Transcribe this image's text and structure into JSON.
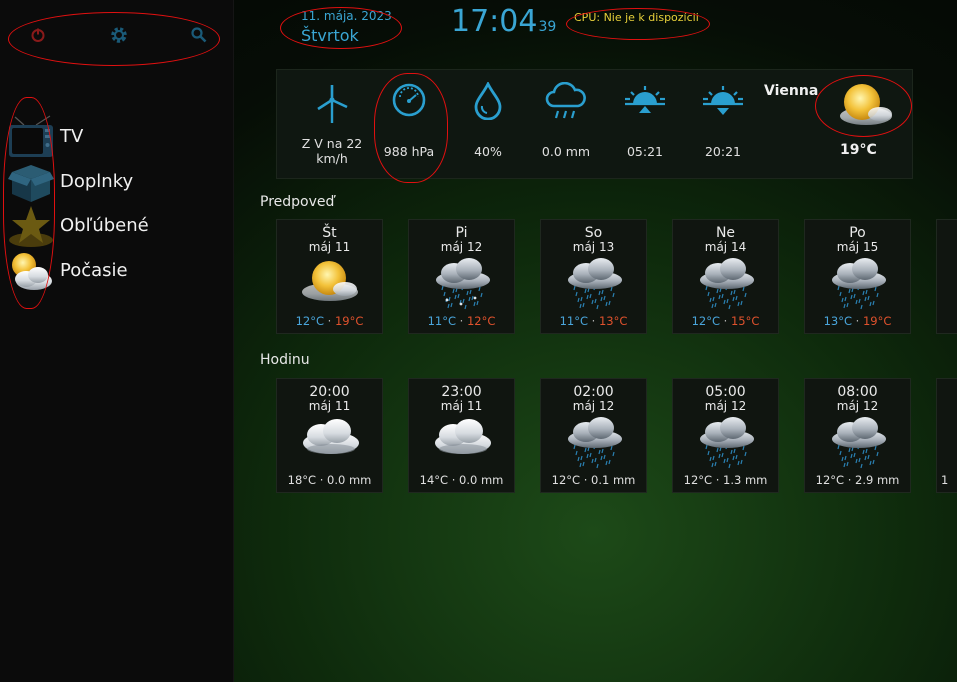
{
  "header": {
    "date": "11. mája. 2023",
    "weekday": "Štvrtok",
    "time": "17:04",
    "seconds": "39",
    "cpu": "CPU: Nie je k dispozícii"
  },
  "sidebar": {
    "top_icons": [
      "power-icon",
      "gear-icon",
      "search-icon"
    ],
    "items": [
      {
        "label": "TV",
        "icon": "tv-icon"
      },
      {
        "label": "Doplnky",
        "icon": "box-icon"
      },
      {
        "label": "Obľúbené",
        "icon": "star-icon"
      },
      {
        "label": "Počasie",
        "icon": "weather-icon"
      }
    ]
  },
  "current": {
    "wind": "Z V na 22 km/h",
    "wind_line1": "Z V na 22",
    "wind_line2": "km/h",
    "pressure": "988 hPa",
    "humidity": "40%",
    "precipitation": "0.0 mm",
    "sunrise": "05:21",
    "sunset": "20:21",
    "city": "Vienna",
    "temperature": "19°C"
  },
  "forecast": {
    "title": "Predpoveď",
    "days": [
      {
        "day": "Št",
        "date": "máj 11",
        "low": "12°C",
        "high": "19°C",
        "icon": "sunny-cloud-icon"
      },
      {
        "day": "Pi",
        "date": "máj 12",
        "low": "11°C",
        "high": "12°C",
        "icon": "rain-snow-icon"
      },
      {
        "day": "So",
        "date": "máj 13",
        "low": "11°C",
        "high": "13°C",
        "icon": "rain-icon"
      },
      {
        "day": "Ne",
        "date": "máj 14",
        "low": "12°C",
        "high": "15°C",
        "icon": "rain-icon"
      },
      {
        "day": "Po",
        "date": "máj 15",
        "low": "13°C",
        "high": "19°C",
        "icon": "rain-icon"
      }
    ]
  },
  "hourly": {
    "title": "Hodinu",
    "hours": [
      {
        "time": "20:00",
        "date": "máj 11",
        "info": "18°C · 0.0 mm",
        "icon": "cloud-icon"
      },
      {
        "time": "23:00",
        "date": "máj 11",
        "info": "14°C · 0.0 mm",
        "icon": "cloud-icon"
      },
      {
        "time": "02:00",
        "date": "máj 12",
        "info": "12°C · 0.1 mm",
        "icon": "rain-icon"
      },
      {
        "time": "05:00",
        "date": "máj 12",
        "info": "12°C · 1.3 mm",
        "icon": "rain-icon"
      },
      {
        "time": "08:00",
        "date": "máj 12",
        "info": "12°C · 2.9 mm",
        "icon": "rain-icon"
      }
    ],
    "partial_next_info": "1"
  },
  "colors": {
    "accent": "#3aa6d4",
    "low": "#4aa6dc",
    "high": "#e0522d",
    "cpu": "#e6cf3a",
    "annotation": "#e01010"
  }
}
